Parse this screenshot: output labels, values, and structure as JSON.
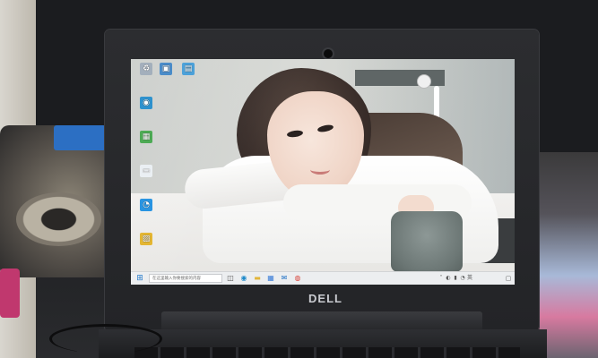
{
  "device": {
    "brand": "DELL"
  },
  "desktop": {
    "icons": [
      {
        "name": "recycle-bin-icon",
        "symbol": "♻",
        "color": "#9aa7b5",
        "label": ""
      },
      {
        "name": "computer-icon",
        "symbol": "▣",
        "color": "#3b82c4",
        "label": ""
      },
      {
        "name": "network-icon",
        "symbol": "▤",
        "color": "#3f9ad6",
        "label": ""
      },
      {
        "name": "edge-icon",
        "symbol": "◉",
        "color": "#1c88c9",
        "label": ""
      },
      {
        "name": "app-green-icon",
        "symbol": "▦",
        "color": "#3fa447",
        "label": ""
      },
      {
        "name": "document-icon",
        "symbol": "▭",
        "color": "#e9eef2",
        "label": ""
      },
      {
        "name": "chat-icon",
        "symbol": "◔",
        "color": "#1e8fe0",
        "label": ""
      },
      {
        "name": "app-yellow-icon",
        "symbol": "▨",
        "color": "#e3b32a",
        "label": ""
      }
    ]
  },
  "taskbar": {
    "start_symbol": "⊞",
    "search_placeholder": "在这里输入你要搜索的内容",
    "apps": [
      {
        "name": "taskview-icon",
        "symbol": "◫",
        "color": "#555555"
      },
      {
        "name": "edge-taskbar-icon",
        "symbol": "◉",
        "color": "#1c88c9"
      },
      {
        "name": "explorer-taskbar-icon",
        "symbol": "▬",
        "color": "#e2b53a"
      },
      {
        "name": "store-taskbar-icon",
        "symbol": "▦",
        "color": "#3b7dd8"
      },
      {
        "name": "mail-taskbar-icon",
        "symbol": "✉",
        "color": "#1d6fc4"
      },
      {
        "name": "chrome-taskbar-icon",
        "symbol": "◍",
        "color": "#d9463d"
      }
    ],
    "tray": {
      "icons": [
        "˄",
        "◐",
        "▮",
        "◔",
        "英"
      ],
      "time": "",
      "date": ""
    },
    "notify_symbol": "▢"
  }
}
